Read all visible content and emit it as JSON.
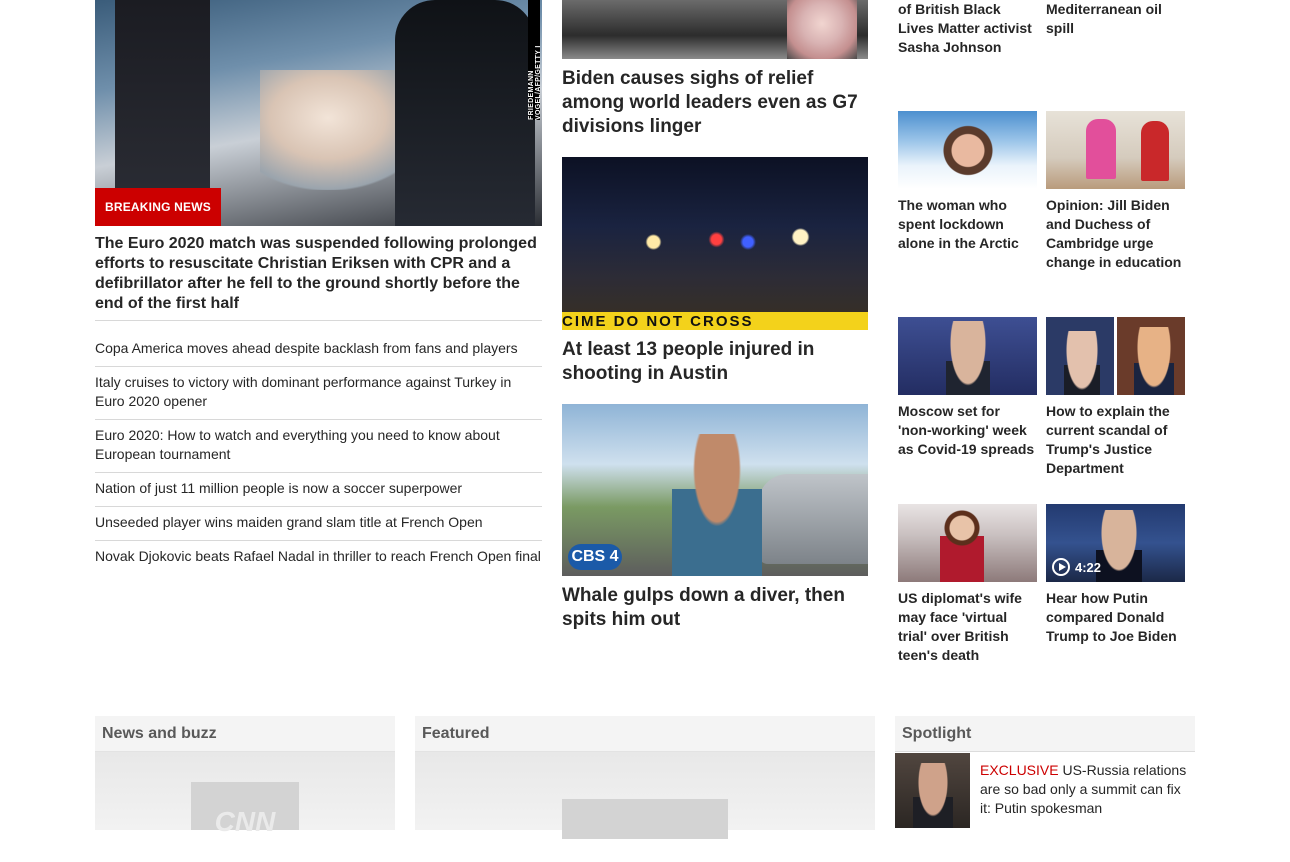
{
  "column1": {
    "hero": {
      "credit": "FRIEDEMANN VOGEL/AFP/GETTY I",
      "badge": "BREAKING NEWS",
      "headline": "The Euro 2020 match was suspended following prolonged efforts to resuscitate Christian Eriksen with CPR and a defibrillator after he fell to the ground shortly before the end of the first half"
    },
    "stories": [
      "Copa America moves ahead despite backlash from fans and players",
      "Italy cruises to victory with dominant performance against Turkey in Euro 2020 opener",
      "Euro 2020: How to watch and everything you need to know about European tournament",
      "Nation of just 11 million people is now a soccer superpower",
      "Unseeded player wins maiden grand slam title at French Open",
      "Novak Djokovic beats Rafael Nadal in thriller to reach French Open final"
    ]
  },
  "column2": {
    "cards": [
      {
        "headline": "Biden causes sighs of relief among world leaders even as G7 divisions linger"
      },
      {
        "headline": "At least 13 people injured in shooting in Austin",
        "tape_text": "CIME DO NOT CROSS"
      },
      {
        "headline": "Whale gulps down a diver, then spits him out",
        "logo_text": "CBS 4"
      }
    ]
  },
  "column3": {
    "left": {
      "top_partial": "charged in shooting of British Black Lives Matter activist Sasha Johnson",
      "cards": [
        {
          "title": "The woman who spent lockdown alone in the Arctic"
        },
        {
          "title": "Moscow set for 'non-working' week as Covid-19 spreads"
        },
        {
          "title": "US diplomat's wife may face 'virtual trial' over British teen's death"
        }
      ]
    },
    "right": {
      "top_partial": "clean up Mediterranean oil spill",
      "cards": [
        {
          "title": "Opinion: Jill Biden and Duchess of Cambridge urge change in education"
        },
        {
          "title": "How to explain the current scandal of Trump's Justice Department"
        },
        {
          "title": "Hear how Putin compared Donald Trump to Joe Biden",
          "duration": "4:22"
        }
      ]
    }
  },
  "zones": {
    "news": {
      "title": "News and buzz",
      "placeholder": "CNN"
    },
    "featured": {
      "title": "Featured"
    },
    "spotlight": {
      "title": "Spotlight",
      "item": {
        "kicker": "EXCLUSIVE",
        "text": "US-Russia relations are so bad only a summit can fix it: Putin spokesman"
      }
    }
  },
  "colors": {
    "accent_red": "#cc0000",
    "text": "#262626",
    "zone_bg": "#f4f4f4"
  }
}
